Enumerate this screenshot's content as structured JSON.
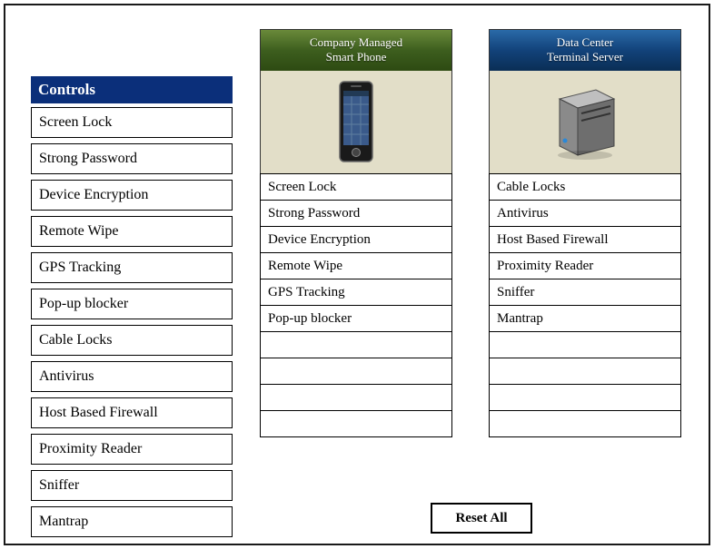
{
  "controls": {
    "header": "Controls",
    "items": [
      "Screen Lock",
      "Strong Password",
      "Device Encryption",
      "Remote Wipe",
      "GPS Tracking",
      "Pop-up blocker",
      "Cable Locks",
      "Antivirus",
      "Host Based Firewall",
      "Proximity Reader",
      "Sniffer",
      "Mantrap"
    ]
  },
  "devices": {
    "phone": {
      "title_line1": "Company Managed",
      "title_line2": "Smart Phone",
      "slots": [
        "Screen Lock",
        "Strong Password",
        "Device Encryption",
        "Remote Wipe",
        "GPS Tracking",
        "Pop-up blocker",
        "",
        "",
        "",
        ""
      ]
    },
    "server": {
      "title_line1": "Data Center",
      "title_line2": "Terminal Server",
      "slots": [
        "Cable Locks",
        "Antivirus",
        "Host Based Firewall",
        "Proximity Reader",
        "Sniffer",
        "Mantrap",
        "",
        "",
        "",
        ""
      ]
    }
  },
  "buttons": {
    "reset": "Reset All"
  },
  "icons": {
    "phone": "smartphone-icon",
    "server": "server-icon"
  },
  "colors": {
    "controls_header_bg": "#0b2f7a",
    "title_green_from": "#6a8a3a",
    "title_green_to": "#2d4a12",
    "title_blue_from": "#2a6aa8",
    "title_blue_to": "#0a2e55"
  }
}
